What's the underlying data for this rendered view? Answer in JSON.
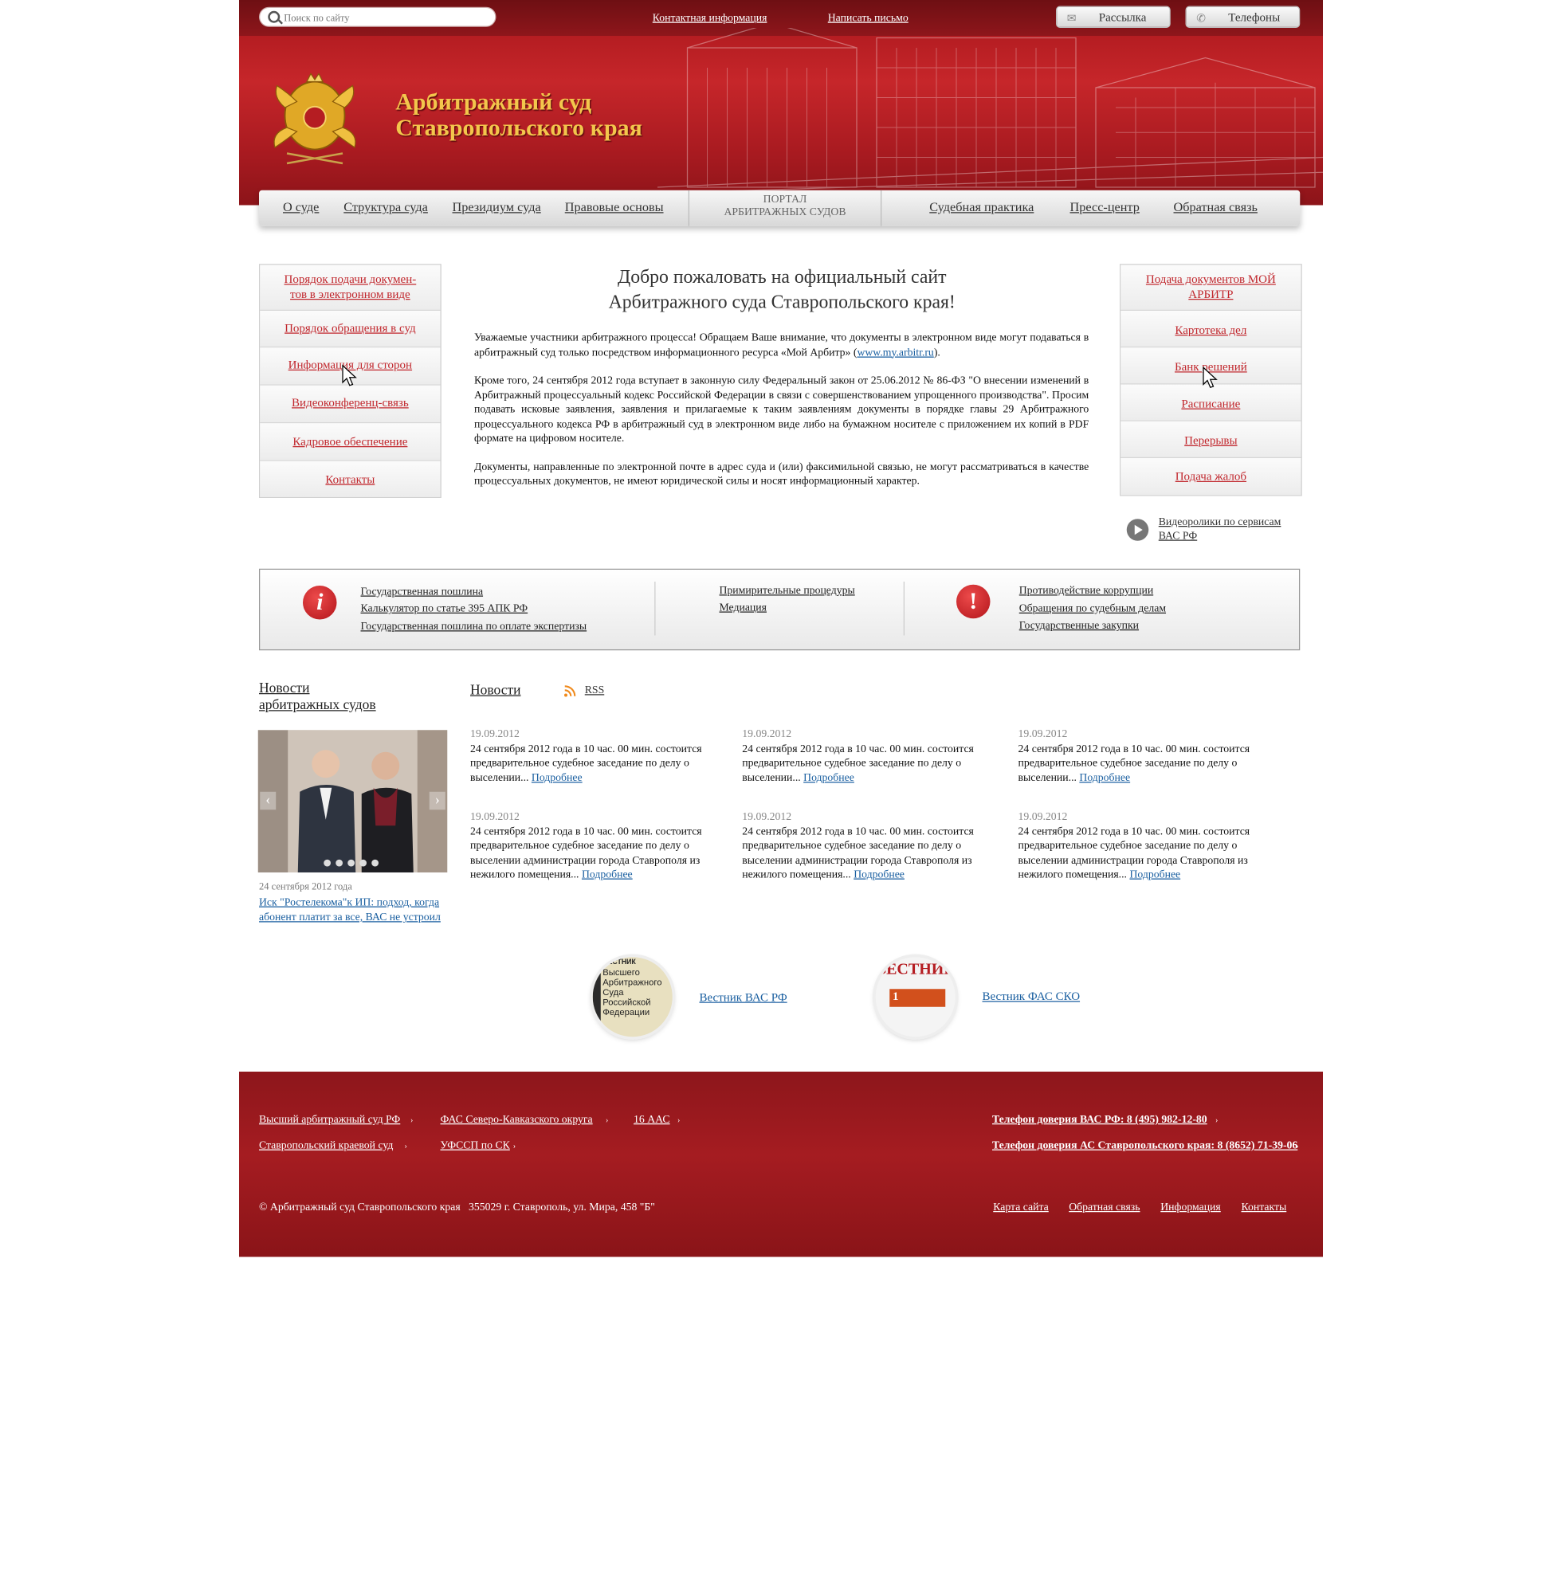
{
  "colors": {
    "brand_red": "#b51d22",
    "link_red": "#c1272d",
    "link_blue": "#1a5fa0",
    "title_gold": "#f3c64c"
  },
  "search": {
    "placeholder": "Поиск по сайту",
    "icon": "search-icon"
  },
  "topbar": {
    "contact": "Контактная информация",
    "write": "Написать письмо",
    "mailing": "Рассылка",
    "mailing_icon": "mail-icon",
    "phones": "Телефоны",
    "phones_icon": "phone-icon"
  },
  "site": {
    "title_line1": "Арбитражный суд",
    "title_line2": "Ставропольского края",
    "emblem": "coat-of-arms-emblem"
  },
  "nav": {
    "items": [
      "О суде",
      "Структура суда",
      "Президиум суда",
      "Правовые основы",
      "Судебная практика",
      "Пресс-центр",
      "Обратная связь"
    ],
    "portal_line1": "ПОРТАЛ",
    "portal_line2": "АРБИТРАЖНЫХ СУДОВ"
  },
  "left_menu": [
    "Порядок подачи докумен-",
    "тов в электронном виде",
    "Порядок обращения в суд",
    "Информация для сторон",
    "Видеоконференц-связь",
    "Кадровое обеспечение",
    "Контакты"
  ],
  "right_menu": [
    "Подача документов МОЙ",
    "АРБИТР",
    "Картотека дел",
    "Банк решений",
    "Расписание",
    "Перерывы",
    "Подача жалоб"
  ],
  "welcome": {
    "line1": "Добро пожаловать на официальный сайт",
    "line2": "Арбитражного суда Ставропольского края!"
  },
  "intro": {
    "p1_text": "Уважаемые участники арбитражного процесса! Обращаем Ваше внимание, что документы в электронном виде могут подаваться в арбитражный суд только посредством информационного ресурса «Мой Арбитр» (",
    "p1_link": "www.my.arbitr.ru",
    "p1_end": ").",
    "p2": "Кроме того, 24 сентября 2012 года вступает в законную силу Федеральный закон от 25.06.2012 № 86-ФЗ  \"О внесении изменений в Арбитражный процессуальный кодекс Российской Федерации в связи с совершенствованием упрощенного производства\". Просим подавать исковые заявления, заявления и прилагаемые к таким заявлениям документы в порядке главы 29 Арбитражного процессуального кодекса РФ в арбитражный суд в электронном виде либо на бумажном носителе с приложением их копий в PDF формате на цифровом носителе.",
    "p3": "Документы, направленные по электронной почте в адрес суда и (или) факсимильной связью, не могут рассматриваться в качестве процессуальных документов, не имеют юридической силы и носят информационный характер."
  },
  "video": {
    "line1": "Видеоролики по сервисам",
    "line2": "ВАС РФ",
    "icon": "play-icon"
  },
  "info": {
    "col1": [
      "Государственная пошлина",
      "Калькулятор по статье 395 АПК РФ",
      "Государственная пошлина по оплате экспертизы"
    ],
    "col2": [
      "Примирительные процедуры",
      "Медиация"
    ],
    "col3": [
      "Противодействие коррупции",
      "Обращения по судебным делам",
      "Государственные закупки"
    ],
    "icon1": "i",
    "icon2": "!"
  },
  "sidebar_news": {
    "heading_line1": "Новости",
    "heading_line2": "арбитражных судов",
    "prev": "‹",
    "next": "›",
    "date": "24 сентября 2012 года",
    "title_line1": "Иск \"Ростелекома\"к ИП: подход, когда",
    "title_line2": "абонент платит за все, ВАС не устроил"
  },
  "news": {
    "heading": "Новости",
    "rss": "RSS",
    "more": "Подробнее",
    "items": [
      {
        "date": "19.09.2012",
        "l1": "24 сентября 2012 года в 10 час. 00 мин. состоится",
        "l2": "предварительное судебное заседание по делу о",
        "l3": "выселении...",
        "l4": ""
      },
      {
        "date": "19.09.2012",
        "l1": "24 сентября 2012 года в 10 час. 00 мин. состоится",
        "l2": "предварительное судебное заседание по делу о",
        "l3": "выселении...",
        "l4": ""
      },
      {
        "date": "19.09.2012",
        "l1": "24 сентября 2012 года в 10 час. 00 мин. состоится",
        "l2": "предварительное судебное заседание по делу о",
        "l3": "выселении...",
        "l4": ""
      },
      {
        "date": "19.09.2012",
        "l1": "24 сентября 2012 года в 10 час. 00 мин. состоится",
        "l2": "предварительное судебное заседание по делу о",
        "l3": "выселении администрации города Ставрополя из",
        "l4": "нежилого помещения..."
      },
      {
        "date": "19.09.2012",
        "l1": "24 сентября 2012 года в 10 час. 00 мин. состоится",
        "l2": "предварительное судебное заседание по делу о",
        "l3": "выселении администрации города Ставрополя из",
        "l4": "нежилого помещения..."
      },
      {
        "date": "19.09.2012",
        "l1": "24 сентября 2012 года в 10 час. 00 мин. состоится",
        "l2": "предварительное судебное заседание по делу о",
        "l3": "выселении администрации города Ставрополя из",
        "l4": "нежилого помещения..."
      }
    ]
  },
  "journals": {
    "vas_link": "Вестник ВАС РФ",
    "vas_cover_l1": "ВЕСТНИК",
    "vas_cover_l2": "Высшего",
    "vas_cover_l3": "Арбитражного",
    "vas_cover_l4": "Суда Российской",
    "vas_cover_l5": "Федерации",
    "fas_link": "Вестник ФАС СКО",
    "fas_cover_title": "ВЕСТНИК",
    "fas_cover_num": "1"
  },
  "footer": {
    "links_row1": [
      "Высший арбитражный суд РФ",
      "ФАС Северо-Кавказского округа",
      "16 ААС"
    ],
    "links_row2": [
      "Ставропольский краевой суд",
      "УФССП по СК"
    ],
    "phone_vas": "Телефон доверия ВАС РФ: 8 (495) 982-12-80",
    "phone_as": "Телефон доверия АС Ставропольского края: 8 (8652) 71-39-06",
    "copyright": "© Арбитражный суд Ставропольского края",
    "address": "355029 г. Ставрополь, ул. Мира, 458 \"Б\"",
    "bottom_links": [
      "Карта сайта",
      "Обратная связь",
      "Информация",
      "Контакты"
    ],
    "arrow": "›"
  }
}
